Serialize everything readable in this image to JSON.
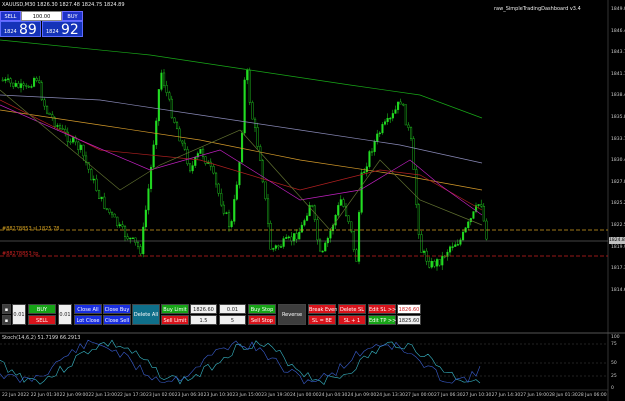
{
  "window": {
    "title": "XAUUSD,M30  1826.30 1827.48 1824.75 1824.89",
    "indicator_name": "raw_SimpleTradingDashboard v3.4"
  },
  "quick_trade": {
    "sell_label": "SELL",
    "buy_label": "BUY",
    "lot_value": "100.00",
    "bid_small": "1824",
    "bid_big": "89",
    "ask_small": "1824",
    "ask_big": "92"
  },
  "price_axis": {
    "ticks": [
      "1849.00",
      "1846.40",
      "1843.70",
      "1841.10",
      "1838.40",
      "1835.80",
      "1833.10",
      "1830.40",
      "1827.80",
      "1825.20",
      "1822.50",
      "1819.90",
      "1817.30",
      "1814.60"
    ],
    "current_price": "1824.89",
    "current_tag": "1824.89",
    "upper_line_label": "#88278853 sl 1825.78",
    "lower_line_label": "#88278853 tp"
  },
  "dashboard": {
    "buy": "BUY",
    "sell": "SELL",
    "lot_small": "0.01",
    "lot_right": "0.01",
    "close_all": "Close All",
    "close_buy": "Close Buy",
    "lot_close": "Lot Close",
    "close_sell": "Close Sell",
    "delete_all": "Delete All",
    "buy_limit": "Buy Limit",
    "sell_limit": "Sell Limit",
    "price_input": "1826.60",
    "pend_lot": "0.01",
    "step_a": "1.5",
    "step_b": "5",
    "buy_stop": "Buy Stop",
    "sell_stop": "Sell Stop",
    "reverse": "Reverse",
    "break_even": "Break Even",
    "sl_be": "SL = BE",
    "delete_sl": "Delete SL",
    "sl_plus1": "SL + 1",
    "edit_sl": "Edit SL >>",
    "edit_tp": "Edit TP >>",
    "edit_sl_value": "1826.60",
    "edit_tp_value": "1825.60"
  },
  "oscillator": {
    "label": "Stoch(14,6,2) 51.7199 66.2913",
    "ticks": [
      "100",
      "75",
      "50",
      "25",
      "0"
    ]
  },
  "time_axis": [
    "22 Jun 2022",
    "22 Jun 01:30",
    "22 Jun 09:00",
    "22 Jun 13:00",
    "22 Jun 17:30",
    "23 Jun 02:00",
    "23 Jun 06:30",
    "23 Jun 10:30",
    "23 Jun 15:00",
    "23 Jun 19:30",
    "24 Jun 00:00",
    "24 Jun 04:30",
    "24 Jun 09:00",
    "24 Jun 13:30",
    "27 Jun 00:00",
    "27 Jun 06:30",
    "27 Jun 10:30",
    "27 Jun 14:30",
    "27 Jun 19:00",
    "28 Jun 01:30",
    "28 Jun 06:00"
  ],
  "colors": {
    "bull": "#22dd22",
    "bear": "#000000",
    "ma_green": "#18a818",
    "ma_blue": "#8a8ab8",
    "ma_orange": "#d49a2a",
    "ma_red": "#b02020",
    "ma_magenta": "#c020c0",
    "ma_olive": "#607030"
  }
}
